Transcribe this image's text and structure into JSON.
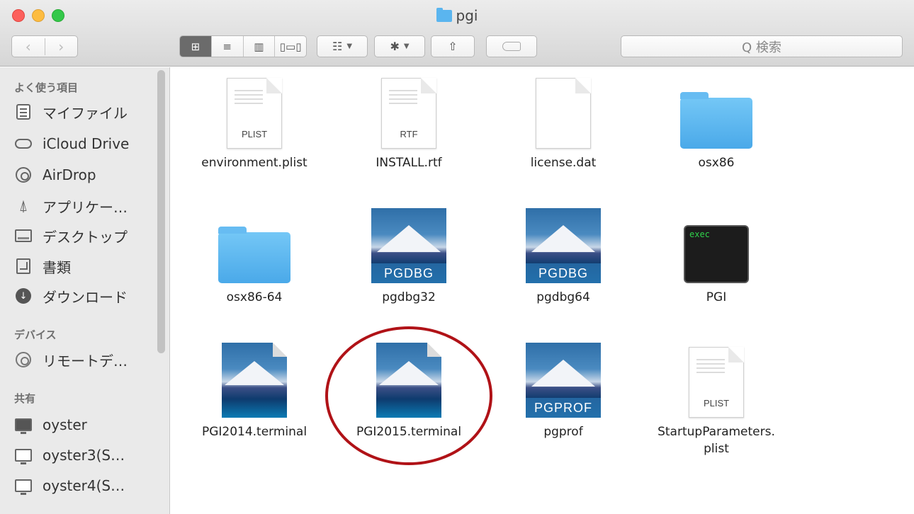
{
  "window": {
    "title": "pgi"
  },
  "toolbar": {
    "back_icon": "chevron-left-icon",
    "forward_icon": "chevron-right-icon",
    "view_modes": [
      "icon-view-icon",
      "list-view-icon",
      "column-view-icon",
      "coverflow-view-icon"
    ],
    "search_placeholder": "Q 検索"
  },
  "sidebar": {
    "favorites_header": "よく使う項目",
    "favorites": [
      {
        "label": "マイファイル",
        "icon": "all-my-files-icon"
      },
      {
        "label": "iCloud Drive",
        "icon": "cloud-icon"
      },
      {
        "label": "AirDrop",
        "icon": "airdrop-icon"
      },
      {
        "label": "アプリケー…",
        "icon": "applications-icon"
      },
      {
        "label": "デスクトップ",
        "icon": "desktop-icon"
      },
      {
        "label": "書類",
        "icon": "documents-icon"
      },
      {
        "label": "ダウンロード",
        "icon": "downloads-icon"
      }
    ],
    "devices_header": "デバイス",
    "devices": [
      {
        "label": "リモートデ…",
        "icon": "remote-disc-icon"
      }
    ],
    "shared_header": "共有",
    "shared": [
      {
        "label": "oyster",
        "icon": "computer-icon"
      },
      {
        "label": "oyster3(S…",
        "icon": "computer-icon"
      },
      {
        "label": "oyster4(S…",
        "icon": "computer-icon"
      }
    ]
  },
  "files": [
    {
      "name": "environment.plist",
      "kind": "doc",
      "badge": "PLIST"
    },
    {
      "name": "INSTALL.rtf",
      "kind": "doc",
      "badge": "RTF"
    },
    {
      "name": "license.dat",
      "kind": "blank"
    },
    {
      "name": "osx86",
      "kind": "folder"
    },
    {
      "name": "osx86-64",
      "kind": "folder"
    },
    {
      "name": "pgdbg32",
      "kind": "app",
      "badge": "PGDBG"
    },
    {
      "name": "pgdbg64",
      "kind": "app",
      "badge": "PGDBG"
    },
    {
      "name": "PGI",
      "kind": "exec",
      "badge": "exec"
    },
    {
      "name": "PGI2014.terminal",
      "kind": "terminal"
    },
    {
      "name": "PGI2015.terminal",
      "kind": "terminal",
      "highlighted": true
    },
    {
      "name": "pgprof",
      "kind": "app",
      "badge": "PGPROF"
    },
    {
      "name": "StartupParameters.\nplist",
      "kind": "doc",
      "badge": "PLIST"
    }
  ],
  "colors": {
    "highlight_circle": "#b01217",
    "folder_blue": "#4aa9e9",
    "sidebar_bg": "#eaeaea"
  }
}
